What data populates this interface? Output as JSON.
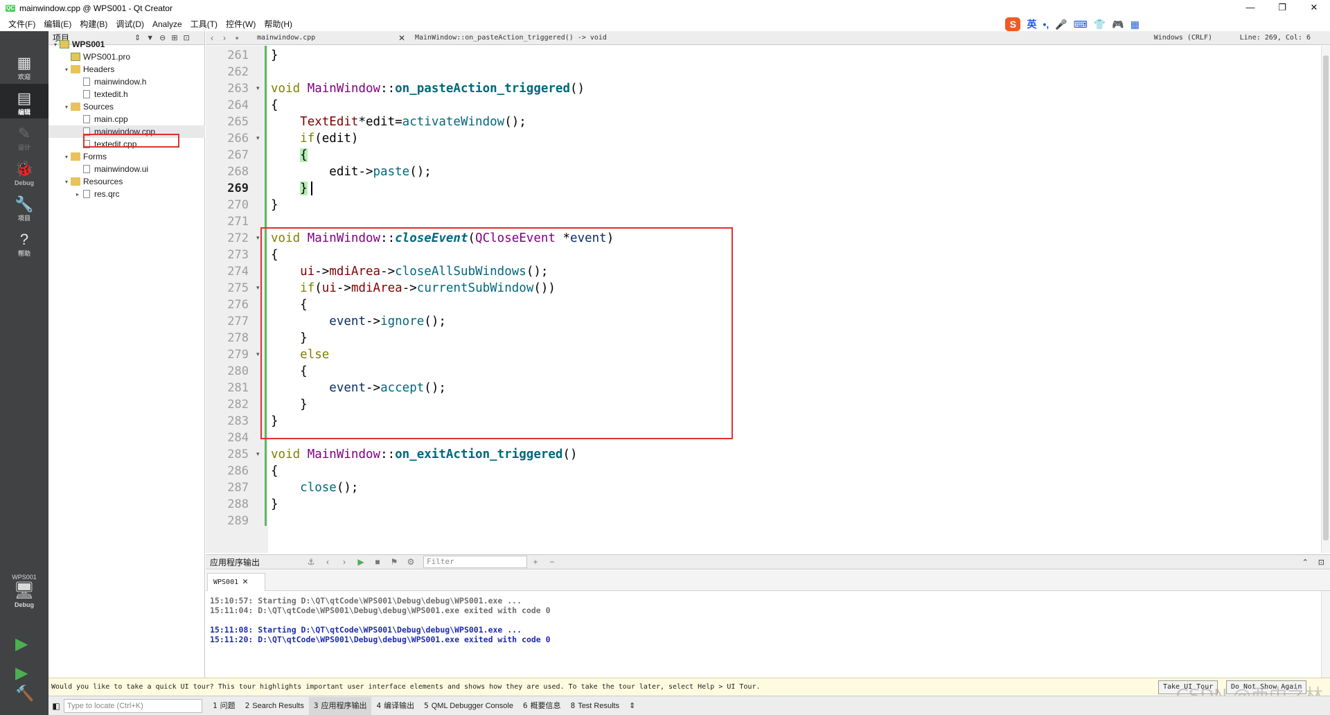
{
  "window": {
    "title": "mainwindow.cpp @ WPS001 - Qt Creator",
    "app_icon_text": "QC",
    "minimize": "—",
    "restore": "❐",
    "close": "✕"
  },
  "menu": [
    "文件(F)",
    "编辑(E)",
    "构建(B)",
    "调试(D)",
    "Analyze",
    "工具(T)",
    "控件(W)",
    "帮助(H)"
  ],
  "ime_bar": {
    "logo": "S",
    "items": [
      "英",
      "•,",
      "🎤",
      "⌨",
      "👕",
      "🎮",
      "▦"
    ]
  },
  "modes": [
    {
      "icon": "▦",
      "label": "欢迎"
    },
    {
      "icon": "▤",
      "label": "编辑"
    },
    {
      "icon": "✎",
      "label": "设计"
    },
    {
      "icon": "🐞",
      "label": "Debug"
    },
    {
      "icon": "🔧",
      "label": "项目"
    },
    {
      "icon": "?",
      "label": "帮助"
    }
  ],
  "kit": {
    "name": "WPS001",
    "icon": "🖥",
    "label": "Debug"
  },
  "project_panel": {
    "title": "项目",
    "tree": [
      {
        "label": "WPS001",
        "arrow": "▾",
        "type": "proj",
        "bold": true
      },
      {
        "label": "WPS001.pro",
        "arrow": "",
        "type": "pro"
      },
      {
        "label": "Headers",
        "arrow": "▾",
        "type": "folder"
      },
      {
        "label": "mainwindow.h",
        "arrow": "",
        "type": "file"
      },
      {
        "label": "textedit.h",
        "arrow": "",
        "type": "file"
      },
      {
        "label": "Sources",
        "arrow": "▾",
        "type": "folder"
      },
      {
        "label": "main.cpp",
        "arrow": "",
        "type": "file"
      },
      {
        "label": "mainwindow.cpp",
        "arrow": "",
        "type": "file",
        "selected": true
      },
      {
        "label": "textedit.cpp",
        "arrow": "",
        "type": "file"
      },
      {
        "label": "Forms",
        "arrow": "▾",
        "type": "folder"
      },
      {
        "label": "mainwindow.ui",
        "arrow": "",
        "type": "ui"
      },
      {
        "label": "Resources",
        "arrow": "▾",
        "type": "folder"
      },
      {
        "label": "res.qrc",
        "arrow": "▸",
        "type": "file"
      }
    ]
  },
  "editor_toolbar": {
    "document": "mainwindow.cpp",
    "function": "MainWindow::on_pasteAction_triggered() -> void",
    "line_ending": "Windows (CRLF)",
    "position": "Line: 269, Col: 6"
  },
  "editor": {
    "current_line": 269,
    "lines": [
      261,
      262,
      263,
      264,
      265,
      266,
      267,
      268,
      269,
      270,
      271,
      272,
      273,
      274,
      275,
      276,
      277,
      278,
      279,
      280,
      281,
      282,
      283,
      284,
      285,
      286,
      287,
      288,
      289
    ],
    "fold_lines": [
      263,
      266,
      272,
      275,
      279,
      285
    ],
    "code": [
      [
        {
          "t": "}"
        }
      ],
      [],
      [
        {
          "t": "void",
          "c": "kw"
        },
        {
          "t": " "
        },
        {
          "t": "MainWindow",
          "c": "ty"
        },
        {
          "t": "::"
        },
        {
          "t": "on_pasteAction_triggered",
          "c": "fn"
        },
        {
          "t": "()"
        }
      ],
      [
        {
          "t": "{"
        }
      ],
      [
        {
          "t": "    "
        },
        {
          "t": "TextEdit",
          "c": "mem"
        },
        {
          "t": "*edit="
        },
        {
          "t": "activateWindow",
          "c": "call"
        },
        {
          "t": "();"
        }
      ],
      [
        {
          "t": "    "
        },
        {
          "t": "if",
          "c": "kw"
        },
        {
          "t": "(edit)"
        }
      ],
      [
        {
          "t": "    "
        },
        {
          "t": "{",
          "c": "hlbrace"
        }
      ],
      [
        {
          "t": "        edit->"
        },
        {
          "t": "paste",
          "c": "call"
        },
        {
          "t": "();"
        }
      ],
      [
        {
          "t": "    "
        },
        {
          "t": "}",
          "c": "hlbrace"
        }
      ],
      [
        {
          "t": "}"
        }
      ],
      [],
      [
        {
          "t": "void",
          "c": "kw"
        },
        {
          "t": " "
        },
        {
          "t": "MainWindow",
          "c": "ty"
        },
        {
          "t": "::"
        },
        {
          "t": "closeEvent",
          "c": "fni"
        },
        {
          "t": "("
        },
        {
          "t": "QCloseEvent",
          "c": "ty"
        },
        {
          "t": " *"
        },
        {
          "t": "event",
          "c": "param"
        },
        {
          "t": ")"
        }
      ],
      [
        {
          "t": "{"
        }
      ],
      [
        {
          "t": "    "
        },
        {
          "t": "ui",
          "c": "mem"
        },
        {
          "t": "->"
        },
        {
          "t": "mdiArea",
          "c": "mem"
        },
        {
          "t": "->"
        },
        {
          "t": "closeAllSubWindows",
          "c": "call"
        },
        {
          "t": "();"
        }
      ],
      [
        {
          "t": "    "
        },
        {
          "t": "if",
          "c": "kw"
        },
        {
          "t": "("
        },
        {
          "t": "ui",
          "c": "mem"
        },
        {
          "t": "->"
        },
        {
          "t": "mdiArea",
          "c": "mem"
        },
        {
          "t": "->"
        },
        {
          "t": "currentSubWindow",
          "c": "call"
        },
        {
          "t": "())"
        }
      ],
      [
        {
          "t": "    {"
        }
      ],
      [
        {
          "t": "        "
        },
        {
          "t": "event",
          "c": "param"
        },
        {
          "t": "->"
        },
        {
          "t": "ignore",
          "c": "call"
        },
        {
          "t": "();"
        }
      ],
      [
        {
          "t": "    }"
        }
      ],
      [
        {
          "t": "    "
        },
        {
          "t": "else",
          "c": "kw"
        }
      ],
      [
        {
          "t": "    {"
        }
      ],
      [
        {
          "t": "        "
        },
        {
          "t": "event",
          "c": "param"
        },
        {
          "t": "->"
        },
        {
          "t": "accept",
          "c": "call"
        },
        {
          "t": "();"
        }
      ],
      [
        {
          "t": "    }"
        }
      ],
      [
        {
          "t": "}"
        }
      ],
      [],
      [
        {
          "t": "void",
          "c": "kw"
        },
        {
          "t": " "
        },
        {
          "t": "MainWindow",
          "c": "ty"
        },
        {
          "t": "::"
        },
        {
          "t": "on_exitAction_triggered",
          "c": "fn"
        },
        {
          "t": "()"
        }
      ],
      [
        {
          "t": "{"
        }
      ],
      [
        {
          "t": "    "
        },
        {
          "t": "close",
          "c": "call"
        },
        {
          "t": "();"
        }
      ],
      [
        {
          "t": "}"
        }
      ],
      []
    ]
  },
  "output_pane": {
    "title": "应用程序输出",
    "filter_placeholder": "Filter",
    "tab": "WPS001",
    "lines": [
      {
        "text": "15:10:57: Starting D:\\QT\\qtCode\\WPS001\\Debug\\debug\\WPS001.exe ...",
        "style": "old"
      },
      {
        "text": "15:11:04: D:\\QT\\qtCode\\WPS001\\Debug\\debug\\WPS001.exe exited with code 0",
        "style": "old"
      },
      {
        "text": "",
        "style": "old"
      },
      {
        "text": "15:11:08: Starting D:\\QT\\qtCode\\WPS001\\Debug\\debug\\WPS001.exe ...",
        "style": "new"
      },
      {
        "text": "15:11:20: D:\\QT\\qtCode\\WPS001\\Debug\\debug\\WPS001.exe exited with code 0",
        "style": "new"
      }
    ]
  },
  "infobar": {
    "message": "Would you like to take a quick UI tour? This tour highlights important user interface elements and shows how they are used. To take the tour later, select Help > UI Tour.",
    "take_tour": "Take UI Tour",
    "dont_show": "Do Not Show Again"
  },
  "watermark": "CSDN @西中之林",
  "statusbar": {
    "locator_placeholder": "Type to locate (Ctrl+K)",
    "tabs": [
      {
        "num": "1",
        "label": "问题"
      },
      {
        "num": "2",
        "label": "Search Results"
      },
      {
        "num": "3",
        "label": "应用程序输出",
        "active": true
      },
      {
        "num": "4",
        "label": "编译输出"
      },
      {
        "num": "5",
        "label": "QML Debugger Console"
      },
      {
        "num": "6",
        "label": "概要信息"
      },
      {
        "num": "8",
        "label": "Test Results"
      }
    ]
  }
}
